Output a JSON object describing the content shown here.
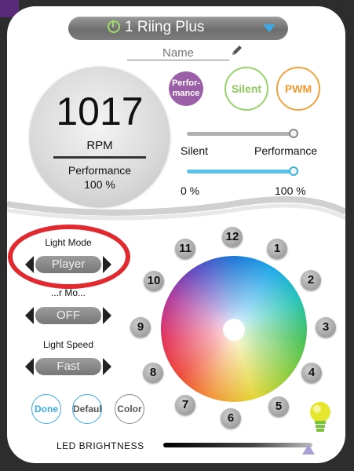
{
  "device": {
    "name": "1 Riing Plus"
  },
  "name_field": {
    "placeholder": "Name"
  },
  "gauge": {
    "rpm": "1017",
    "unit": "RPM",
    "mode": "Performance",
    "percent": "100 %"
  },
  "modes": {
    "performance": "Perfor-\nmance",
    "silent": "Silent",
    "pwm": "PWM"
  },
  "speed_slider": {
    "left_label": "Silent",
    "right_label": "Performance",
    "value": 1.0
  },
  "percent_slider": {
    "left_label": "0 %",
    "right_label": "100 %",
    "value": 1.0
  },
  "light_mode": {
    "label": "Light Mode",
    "value": "Player"
  },
  "second_mode": {
    "label": "...r Mo...",
    "value": "OFF"
  },
  "light_speed": {
    "label": "Light Speed",
    "value": "Fast"
  },
  "clock_numbers": [
    "12",
    "1",
    "2",
    "3",
    "4",
    "5",
    "6",
    "7",
    "8",
    "9",
    "10",
    "11"
  ],
  "buttons": {
    "done": "Done",
    "default": "Defaul",
    "color": "Color"
  },
  "brightness": {
    "label": "LED BRIGHTNESS",
    "value": 1.0
  },
  "colors": {
    "accent_blue": "#3aa9e8",
    "performance_purple": "#9b5fa8",
    "silent_green": "#97d36a",
    "pwm_orange": "#f0a340",
    "highlight_red": "#e12a2f"
  }
}
